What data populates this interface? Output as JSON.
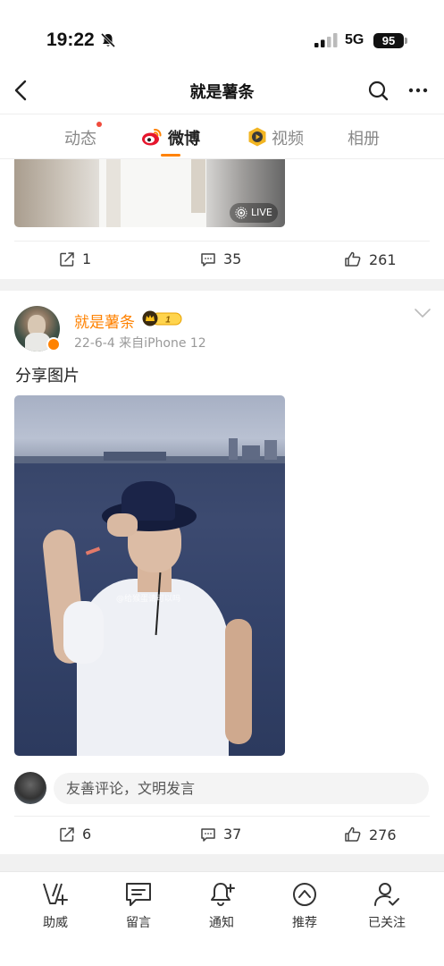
{
  "status_bar": {
    "time": "19:22",
    "network": "5G",
    "battery": "95"
  },
  "nav": {
    "title": "就是薯条"
  },
  "tabs": [
    {
      "label": "动态",
      "has_dot": true
    },
    {
      "label": "微博",
      "active": true
    },
    {
      "label": "视频"
    },
    {
      "label": "相册"
    }
  ],
  "previous_post": {
    "live_label": "LIVE",
    "actions": {
      "repost": "1",
      "comment": "35",
      "like": "261"
    }
  },
  "post": {
    "username": "就是薯条",
    "vip_level": "1",
    "meta": "22-6-4  来自iPhone 12",
    "text": "分享图片",
    "watermark": "@给猴蛋请可以吗",
    "comment_placeholder": "友善评论，文明发言",
    "actions": {
      "repost": "6",
      "comment": "37",
      "like": "276"
    }
  },
  "bottom_bar": [
    {
      "label": "助威",
      "icon": "cheer-icon"
    },
    {
      "label": "留言",
      "icon": "message-icon"
    },
    {
      "label": "通知",
      "icon": "notify-bell-icon"
    },
    {
      "label": "推荐",
      "icon": "recommend-icon"
    },
    {
      "label": "已关注",
      "icon": "followed-icon"
    }
  ],
  "colors": {
    "accent": "#ff8200",
    "notification_dot": "#f04b3c",
    "text": "#222222",
    "muted": "#999999"
  }
}
